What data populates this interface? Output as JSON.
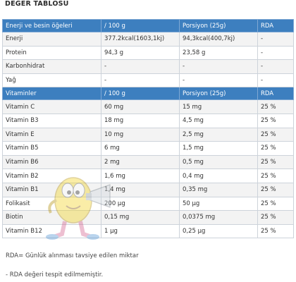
{
  "title": "DEĞER TABLOSU",
  "header1": [
    "Enerji ve besin öğeleri",
    "/ 100 g",
    "Porsiyon (25g)",
    "RDA"
  ],
  "rows1": [
    [
      "Enerji",
      "377.2kcal(1603,1kj)",
      "94,3kcal(400,7kj)",
      "-"
    ],
    [
      "Protein",
      "94,3 g",
      "23,58 g",
      "-"
    ],
    [
      "Karbonhidrat",
      "-",
      "-",
      "-"
    ],
    [
      "Yağ",
      "-",
      "-",
      "-"
    ]
  ],
  "header2": [
    "Vitaminler",
    "/ 100 g",
    "Porsiyon (25g)",
    "RDA"
  ],
  "rows2": [
    [
      "Vitamin C",
      "60 mg",
      "15 mg",
      "25 %"
    ],
    [
      "Vitamin B3",
      "18 mg",
      "4,5 mg",
      "25 %"
    ],
    [
      "Vitamin E",
      "10 mg",
      "2,5 mg",
      "25 %"
    ],
    [
      "Vitamin B5",
      "6 mg",
      "1,5 mg",
      "25 %"
    ],
    [
      "Vitamin B6",
      "2 mg",
      "0,5 mg",
      "25 %"
    ],
    [
      "Vitamin B2",
      "1,6 mg",
      "0,4 mg",
      "25 %"
    ],
    [
      "Vitamin B1",
      "1,4 mg",
      "0,35 mg",
      "25 %"
    ],
    [
      "Folikasit",
      "200 µg",
      "50 µg",
      "25 %"
    ],
    [
      "Biotin",
      "0,15 mg",
      "0,0375 mg",
      "25 %"
    ],
    [
      "Vitamin B12",
      "1 µg",
      "0,25 µg",
      "25 %"
    ]
  ],
  "footnote1": "RDA= Günlük alınması tavsiye edilen miktar",
  "footnote2": "- RDA değeri tespit edilmemiştir.",
  "colors": {
    "header_bg": "#3d7fbf",
    "row_bg": "#f3f3f3",
    "row_alt_bg": "#ffffff"
  },
  "mascot": "cartoon-vitamin-mascot-watermark"
}
